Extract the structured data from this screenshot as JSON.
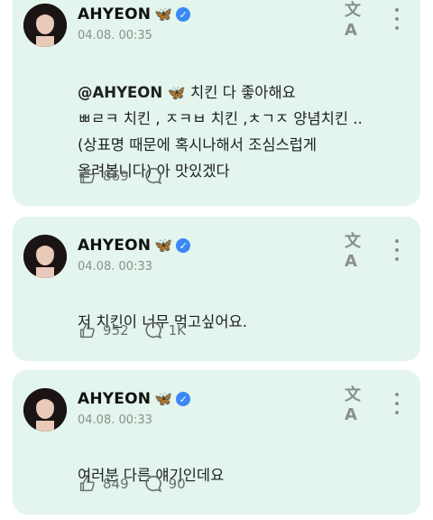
{
  "colors": {
    "card_bg": "#e3f5ec",
    "verified": "#3a88f5",
    "muted": "#8a8f8c"
  },
  "posts": [
    {
      "author": "AHYEON",
      "author_emoji": "🦋",
      "timestamp": "04.08. 00:35",
      "mention": "@AHYEON",
      "mention_emoji": "🦋",
      "text": " 치킨 다 좋아해요\nㅃㄹㅋ 치킨 , ㅈㅋㅂ 치킨 ,ㅊㄱㅈ 양념치킨 ..\n(상표명 때문에 혹시나해서 조심스럽게\n올려봅니다) 아 맛있겠다",
      "likes": "869",
      "comments": ""
    },
    {
      "author": "AHYEON",
      "author_emoji": "🦋",
      "timestamp": "04.08. 00:33",
      "text": "저 치킨이 너무 먹고싶어요.",
      "likes": "952",
      "comments": "1K"
    },
    {
      "author": "AHYEON",
      "author_emoji": "🦋",
      "timestamp": "04.08. 00:33",
      "text": "여러분 다른 얘기인데요",
      "likes": "849",
      "comments": "90"
    }
  ],
  "icons": {
    "verified": "verified-check-icon",
    "translate": "translate-icon",
    "more": "more-vertical-icon",
    "like": "like-hand-icon",
    "comment": "comment-bubble-icon"
  },
  "glyphs": {
    "translate": "文A",
    "check": "✓"
  }
}
